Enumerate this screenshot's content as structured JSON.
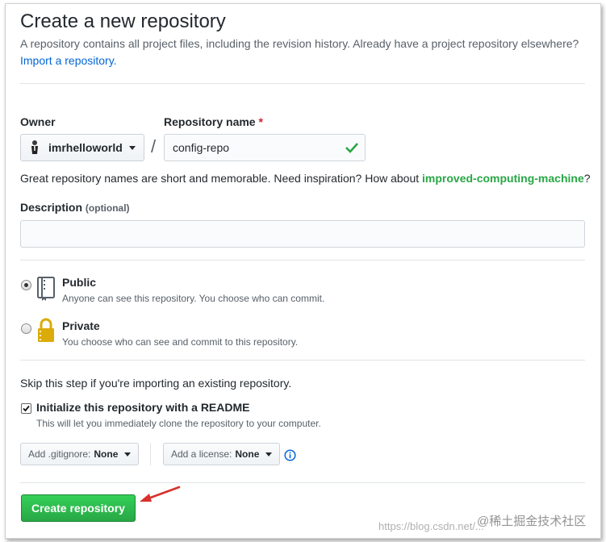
{
  "header": {
    "title": "Create a new repository",
    "subtitle": "A repository contains all project files, including the revision history. Already have a project repository elsewhere?",
    "import_link": "Import a repository."
  },
  "owner": {
    "label": "Owner",
    "value": "imrhelloworld",
    "separator": "/"
  },
  "repo_name": {
    "label": "Repository name",
    "required_mark": "*",
    "value": "config-repo",
    "status": "valid",
    "valid_color": "#28a745"
  },
  "name_hint": {
    "prefix": "Great repository names are short and memorable. Need inspiration? How about ",
    "suggestion": "improved-computing-machine",
    "suffix": "?"
  },
  "description": {
    "label": "Description",
    "optional_note": "(optional)",
    "value": ""
  },
  "visibility": {
    "options": [
      {
        "id": "public",
        "label": "Public",
        "note": "Anyone can see this repository. You choose who can commit.",
        "selected": true,
        "icon": "repo-book-icon"
      },
      {
        "id": "private",
        "label": "Private",
        "note": "You choose who can see and commit to this repository.",
        "selected": false,
        "icon": "lock-icon"
      }
    ]
  },
  "init": {
    "skip_note": "Skip this step if you're importing an existing repository.",
    "readme_label": "Initialize this repository with a README",
    "readme_note": "This will let you immediately clone the repository to your computer.",
    "readme_checked": true,
    "gitignore_label": "Add .gitignore:",
    "gitignore_value": "None",
    "license_label": "Add a license:",
    "license_value": "None",
    "info_icon": "info-icon"
  },
  "submit": {
    "label": "Create repository",
    "color": "#28a745"
  },
  "annotation": {
    "arrow_color": "#d9302c"
  },
  "watermark": {
    "url_text": "https://blog.csdn.net/...",
    "brand_text": "@稀土掘金技术社区"
  },
  "colors": {
    "link": "#0366d6",
    "required": "#cb2431",
    "suggestion": "#28a745"
  }
}
